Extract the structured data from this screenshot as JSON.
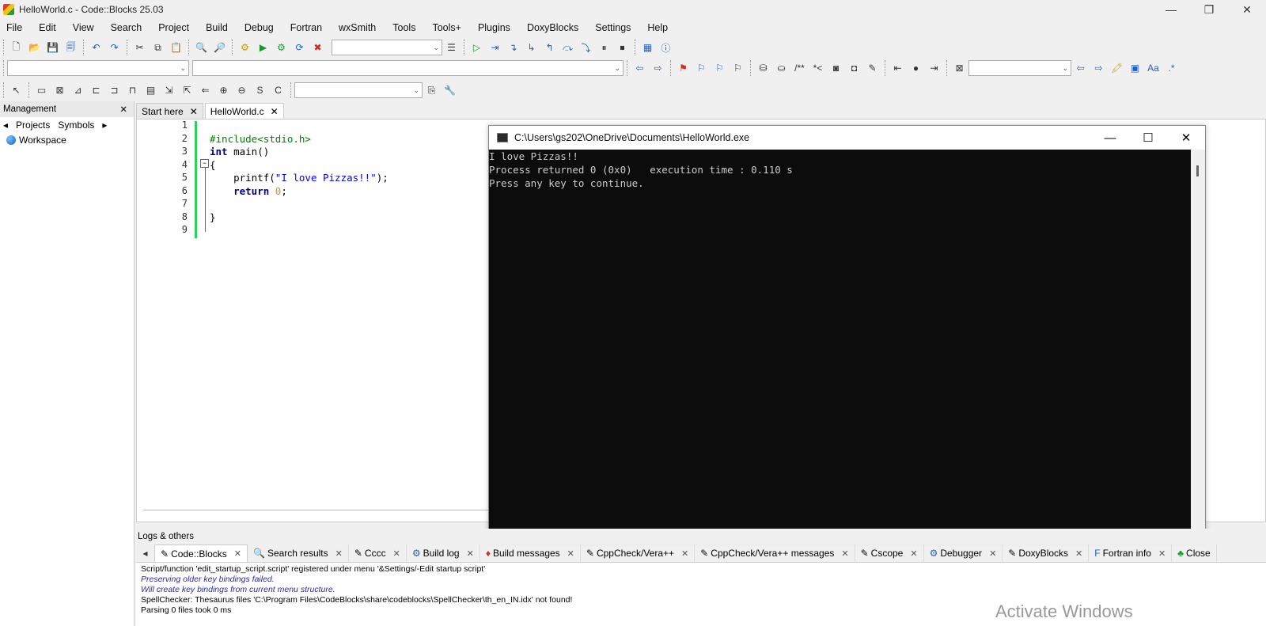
{
  "window": {
    "title": "HelloWorld.c - Code::Blocks 25.03"
  },
  "menu": [
    "File",
    "Edit",
    "View",
    "Search",
    "Project",
    "Build",
    "Debug",
    "Fortran",
    "wxSmith",
    "Tools",
    "Tools+",
    "Plugins",
    "DoxyBlocks",
    "Settings",
    "Help"
  ],
  "management": {
    "title": "Management",
    "tabs": [
      "Projects",
      "Symbols"
    ],
    "workspace": "Workspace"
  },
  "editor": {
    "tabs": [
      "Start here",
      "HelloWorld.c"
    ],
    "line_numbers": [
      "1",
      "2",
      "3",
      "4",
      "5",
      "6",
      "7",
      "8",
      "9"
    ],
    "code": {
      "l2": "#include<stdio.h>",
      "l3_kw": "int",
      "l3_rest": " main()",
      "l4": "{",
      "l5_a": "    printf(",
      "l5_str": "\"I love Pizzas!!\"",
      "l5_b": ");",
      "l6_kw": "    return",
      "l6_num": " 0",
      "l6_b": ";",
      "l8": "}"
    }
  },
  "console": {
    "title": "C:\\Users\\gs202\\OneDrive\\Documents\\HelloWorld.exe",
    "lines": [
      "I love Pizzas!!",
      "Process returned 0 (0x0)   execution time : 0.110 s",
      "Press any key to continue."
    ]
  },
  "logs": {
    "title": "Logs & others",
    "tabs": [
      "Code::Blocks",
      "Search results",
      "Cccc",
      "Build log",
      "Build messages",
      "CppCheck/Vera++",
      "CppCheck/Vera++ messages",
      "Cscope",
      "Debugger",
      "DoxyBlocks",
      "Fortran info",
      "Close"
    ],
    "lines": [
      "Script/function 'edit_startup_script.script' registered under menu '&Settings/-Edit startup script'",
      "Preserving older key bindings failed.",
      "Will create key bindings from current menu structure.",
      "SpellChecker: Thesaurus files 'C:\\Program Files\\CodeBlocks\\share\\codeblocks\\SpellChecker\\th_en_IN.idx' not found!",
      "Parsing 0 files took 0 ms"
    ]
  },
  "watermark": "Activate Windows"
}
